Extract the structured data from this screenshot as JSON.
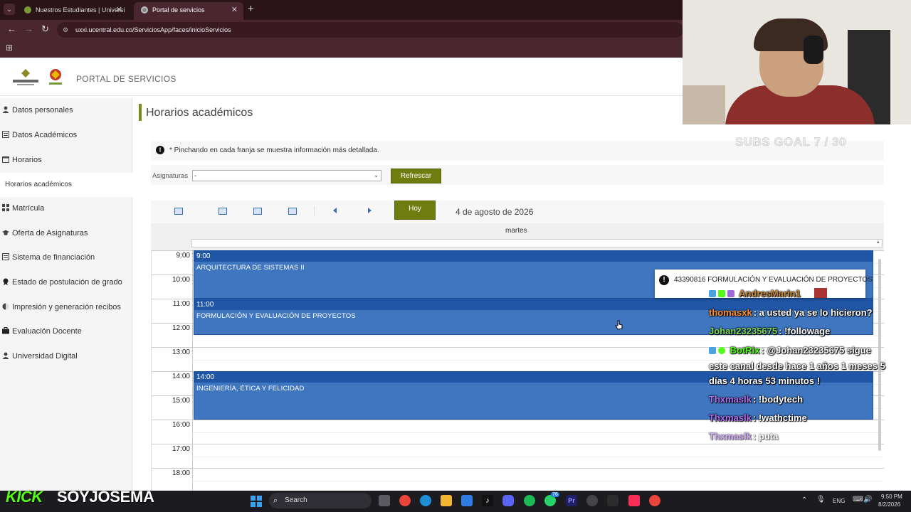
{
  "browser": {
    "tabs": [
      {
        "label": "Nuestros Estudiantes | Universi",
        "active": false
      },
      {
        "label": "Portal de servicios",
        "active": true
      }
    ],
    "url": "uxxi.ucentral.edu.co/ServiciosApp/faces/inicioServicios"
  },
  "header": {
    "title": "PORTAL DE SERVICIOS"
  },
  "sidebar": {
    "items": [
      {
        "label": "Datos personales",
        "icon": "user-icon"
      },
      {
        "label": "Datos Académicos",
        "icon": "document-icon"
      },
      {
        "label": "Horarios",
        "icon": "calendar-icon"
      },
      {
        "label": "Horarios académicos",
        "icon": ""
      },
      {
        "label": "Matrícula",
        "icon": "grid-icon"
      },
      {
        "label": "Oferta de Asignaturas",
        "icon": "graduation-cap-icon"
      },
      {
        "label": "Sistema de financiación",
        "icon": "document-icon"
      },
      {
        "label": "Estado de postulación de grado",
        "icon": "award-icon"
      },
      {
        "label": "Impresión y generación recibos",
        "icon": "half-circle-icon"
      },
      {
        "label": "Evaluación Docente",
        "icon": "briefcase-icon"
      },
      {
        "label": "Universidad Digital",
        "icon": "user-icon"
      }
    ]
  },
  "main": {
    "title": "Horarios académicos",
    "info": "* Pinchando en cada franja se muestra información más detallada.",
    "filter_label": "Asignaturas",
    "filter_value": "-",
    "refresh_label": "Refrescar",
    "today_label": "Hoy",
    "date": "4 de agosto de 2026",
    "day": "martes",
    "hours": [
      "9:00",
      "10:00",
      "11:00",
      "12:00",
      "13:00",
      "14:00",
      "15:00",
      "16:00",
      "17:00",
      "18:00"
    ],
    "events": [
      {
        "time": "9:00",
        "title": "ARQUITECTURA DE SISTEMAS II"
      },
      {
        "time": "11:00",
        "title": "FORMULACIÓN Y EVALUACIÓN DE PROYECTOS"
      },
      {
        "time": "14:00",
        "title": "INGENIERÍA, ÉTICA Y FELICIDAD"
      }
    ],
    "tooltip": "43390816 FORMULACIÓN Y EVALUACIÓN DE PROYECTOS"
  },
  "overlay": {
    "subs_goal": "SUBS GOAL 7 / 30",
    "chat": [
      {
        "user": "AndresMarin1",
        "msg": "",
        "color": "#c98a3a"
      },
      {
        "user": "thomasxk",
        "msg": ": a usted ya se lo hicieron?",
        "color": "#ff8c2a"
      },
      {
        "user": "Johan23235675",
        "msg": ": !followage",
        "color": "#7ed957"
      },
      {
        "user": "BotRix",
        "msg": ": @Johan23235675 sigue",
        "color": "#53fc18"
      },
      {
        "user": "",
        "msg": "este canal desde hace 1 años 1 meses 5",
        "color": "#fff"
      },
      {
        "user": "",
        "msg": "días 4 horas 53 minutos !",
        "color": "#fff"
      },
      {
        "user": "Thxmaslk",
        "msg": ": !bodytech",
        "color": "#b06cf0"
      },
      {
        "user": "Thxmaslk",
        "msg": ": !wathctime",
        "color": "#b06cf0"
      },
      {
        "user": "Thxmaslk",
        "msg": ": puta",
        "color": "#b06cf0"
      }
    ],
    "kick": "KICK",
    "streamer": "SOYJOSEMA"
  },
  "taskbar": {
    "search": "Search",
    "lang": "ENG",
    "time": "9:50 PM",
    "date": "8/2/2026",
    "badge": "76"
  }
}
